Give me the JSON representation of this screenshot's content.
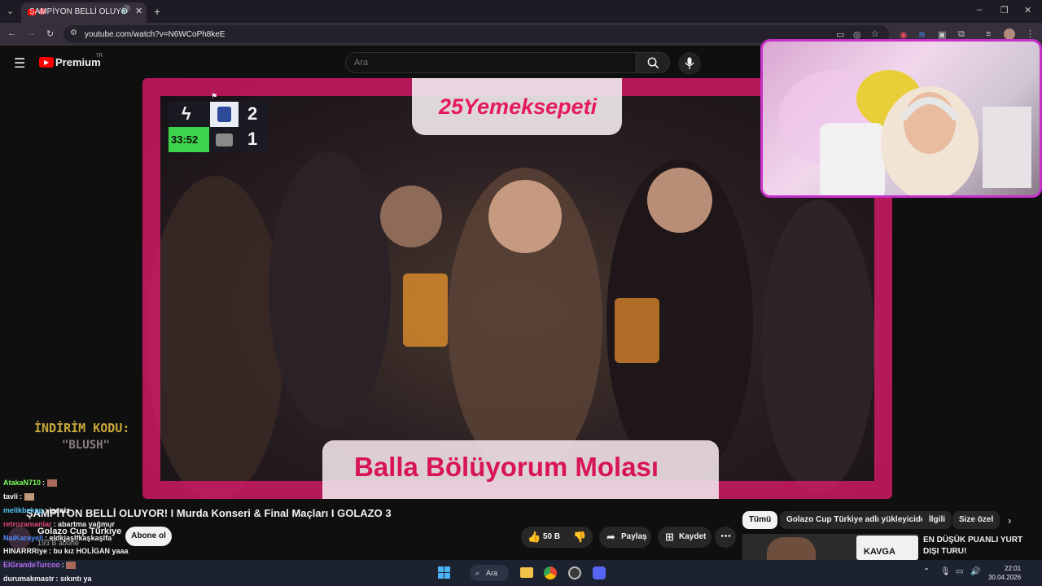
{
  "browser": {
    "tab_title": "ŞAMPİYON BELLİ OLUYO",
    "url": "youtube.com/watch?v=N6WCoPh8keE"
  },
  "youtube": {
    "logo": "Premium",
    "logo_region": "TR",
    "search_placeholder": "Ara"
  },
  "video": {
    "brand": "25Yemeksepeti",
    "caption": "Balla Bölüyorum Molası",
    "scoreboard": {
      "home_score": "2",
      "away_score": "1",
      "clock": "33:52"
    }
  },
  "video_info": {
    "title": "ŞAMPİYON BELLİ OLUYOR! I Murda Konseri & Final Maçları I GOLAZO 3",
    "channel": "Golazo Cup Türkiye",
    "subscribers": "193 B abone",
    "subscribe_label": "Abone ol",
    "likes": "50 B",
    "share_label": "Paylaş",
    "save_label": "Kaydet"
  },
  "chips": [
    "Tümü",
    "Golazo Cup Türkiye adlı yükleyiciden",
    "İlgili",
    "Size özel"
  ],
  "recommendation": {
    "thumb_label": "KAVGA",
    "title": "EN DÜŞÜK PUANLI YURT DIŞI TURU!"
  },
  "overlay": {
    "promo_line1": "İNDİRİM KODU:",
    "promo_line2": "\"BLUSH\""
  },
  "chat": [
    {
      "user": "AtakaN710",
      "msg": ":",
      "color": "#7cfc5a"
    },
    {
      "user": "tavli",
      "msg": ":",
      "color": "#f1f1f1"
    },
    {
      "user": "melikbekep",
      "msg": ": iseniz",
      "color": "#4fc3f7"
    },
    {
      "user": "retrozamanlar",
      "msg": ": abartma yağmur",
      "color": "#e0467a"
    },
    {
      "user": "NaiKarayeli",
      "msg": ": eldkjaşlfkaşkaşlfa",
      "color": "#4f8cf7"
    },
    {
      "user": "HINARRRiye",
      "msg": ": bu kız HOLİGAN yaaa",
      "color": "#f1f1f1"
    },
    {
      "user": "ElGrandeTurcoo",
      "msg": ":",
      "color": "#b66cf0"
    },
    {
      "user": "durumakmastr",
      "msg": ": sıkıntı ya",
      "color": "#f1f1f1"
    }
  ],
  "taskbar": {
    "search": "Ara",
    "time": "22:01",
    "date": "30.04.2026"
  },
  "colors": {
    "accent": "#e6196e",
    "youtube_red": "#ff0000",
    "webcam_border": "#c630c9"
  }
}
